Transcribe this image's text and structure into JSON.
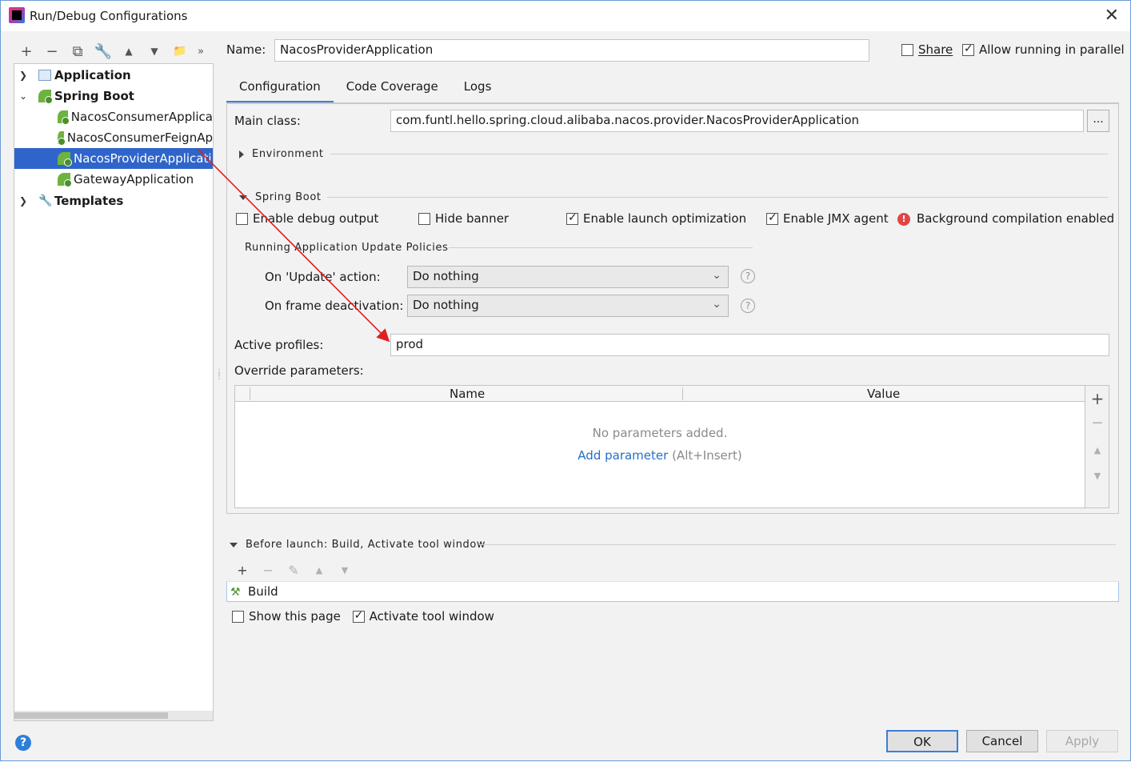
{
  "window": {
    "title": "Run/Debug Configurations"
  },
  "left_toolbar": {
    "add": "+",
    "remove": "−",
    "copy": "⧉",
    "edit": "🔧",
    "up": "▲",
    "down": "▼",
    "folder": "📁",
    "more": "»"
  },
  "tree": {
    "application": "Application",
    "spring_boot": "Spring Boot",
    "items": [
      "NacosConsumerApplica",
      "NacosConsumerFeignAp",
      "NacosProviderApplicati",
      "GatewayApplication"
    ],
    "templates": "Templates"
  },
  "header": {
    "name_label": "Name:",
    "name_value": "NacosProviderApplication",
    "share": "Share",
    "allow_parallel": "Allow running in parallel"
  },
  "tabs": [
    "Configuration",
    "Code Coverage",
    "Logs"
  ],
  "config": {
    "main_class_label": "Main class:",
    "main_class_value": "com.funtl.hello.spring.cloud.alibaba.nacos.provider.NacosProviderApplication",
    "browse": "...",
    "environment": "Environment",
    "spring_boot_section": "Spring Boot",
    "enable_debug": "Enable debug output",
    "hide_banner": "Hide banner",
    "enable_launch_opt": "Enable launch optimization",
    "enable_jmx": "Enable JMX agent",
    "bg_compilation": "Background compilation enabled",
    "policies_title": "Running Application Update Policies",
    "on_update_label": "On 'Update' action:",
    "on_update_value": "Do nothing",
    "on_frame_label": "On frame deactivation:",
    "on_frame_value": "Do nothing",
    "active_profiles_label": "Active profiles:",
    "active_profiles_value": "prod",
    "override_label": "Override parameters:",
    "col_name": "Name",
    "col_value": "Value",
    "empty": "No parameters added.",
    "add_param": "Add parameter",
    "add_param_shortcut": "(Alt+Insert)"
  },
  "before_launch": {
    "title": "Before launch: Build, Activate tool window",
    "item": "Build",
    "show_page": "Show this page",
    "activate_window": "Activate tool window"
  },
  "buttons": {
    "ok": "OK",
    "cancel": "Cancel",
    "apply": "Apply",
    "help": "?"
  },
  "colors": {
    "selection": "#2f65ca",
    "accent": "#3c7ed6",
    "arrow": "#e02020",
    "link": "#2470c8"
  }
}
